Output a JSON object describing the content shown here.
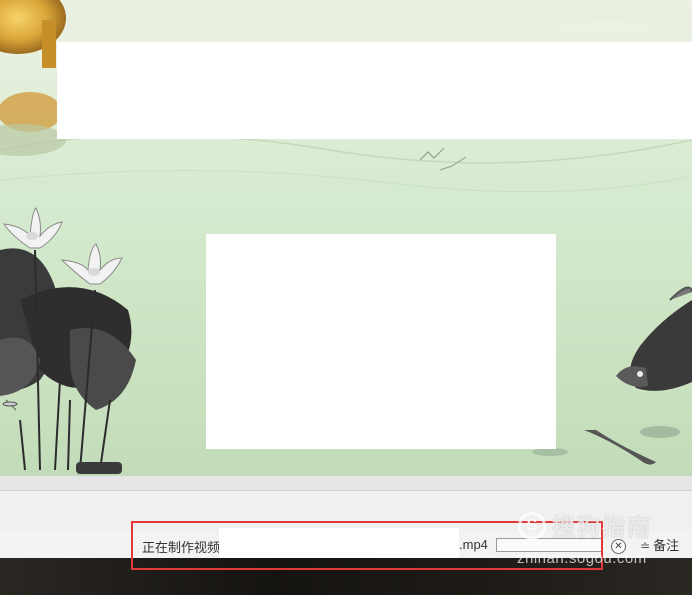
{
  "slide": {},
  "status_bar": {
    "status_text": "正在制作视频",
    "file_ext": ".mp4",
    "progress_value": 0,
    "cancel_symbol": "✕",
    "notes_icon": "notes-icon",
    "notes_label": "备注"
  },
  "watermark": {
    "brand": "搜狗指南",
    "logo_letter": "S",
    "url": "zhinan.sogou.com"
  },
  "colors": {
    "highlight_border": "#e23a3a",
    "progress_fill": "#3c8dd6",
    "status_bar_bg": "#f3f3f3"
  }
}
